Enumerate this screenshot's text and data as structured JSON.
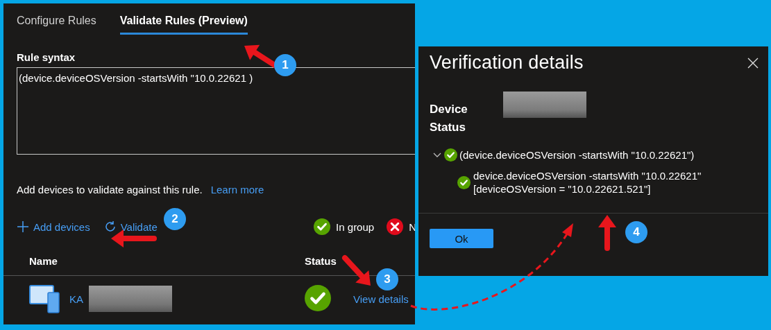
{
  "tabs": [
    {
      "label": "Configure Rules",
      "selected": false
    },
    {
      "label": "Validate Rules (Preview)",
      "selected": true
    }
  ],
  "rule_syntax": {
    "label": "Rule syntax",
    "value": "(device.deviceOSVersion -startsWith \"10.0.22621 )"
  },
  "intro": {
    "text": "Add devices to validate against this rule.",
    "link": "Learn more"
  },
  "toolbar": [
    {
      "label": "Add devices",
      "kind": "add"
    },
    {
      "label": "Validate",
      "kind": "refresh"
    }
  ],
  "legend": [
    {
      "label": "In group",
      "kind": "pass"
    },
    {
      "label": "N",
      "kind": "fail"
    }
  ],
  "table": {
    "columns": [
      "Name",
      "Status"
    ],
    "rows": [
      {
        "name": "KA",
        "kind": "pass",
        "action": "View details"
      }
    ]
  },
  "dialog": {
    "title": "Verification details",
    "device_label": "Device",
    "status_label": "Status",
    "tree": [
      {
        "text": "(device.deviceOSVersion -startsWith \"10.0.22621\")",
        "kind": "pass",
        "expanded": true,
        "children": [
          {
            "text": "device.deviceOSVersion -startsWith \"10.0.22621\"",
            "detail": "[deviceOSVersion = \"10.0.22621.521\"]",
            "kind": "pass"
          }
        ]
      }
    ],
    "buttons": [
      "Ok"
    ]
  },
  "callouts": [
    "1",
    "2",
    "3",
    "4"
  ]
}
